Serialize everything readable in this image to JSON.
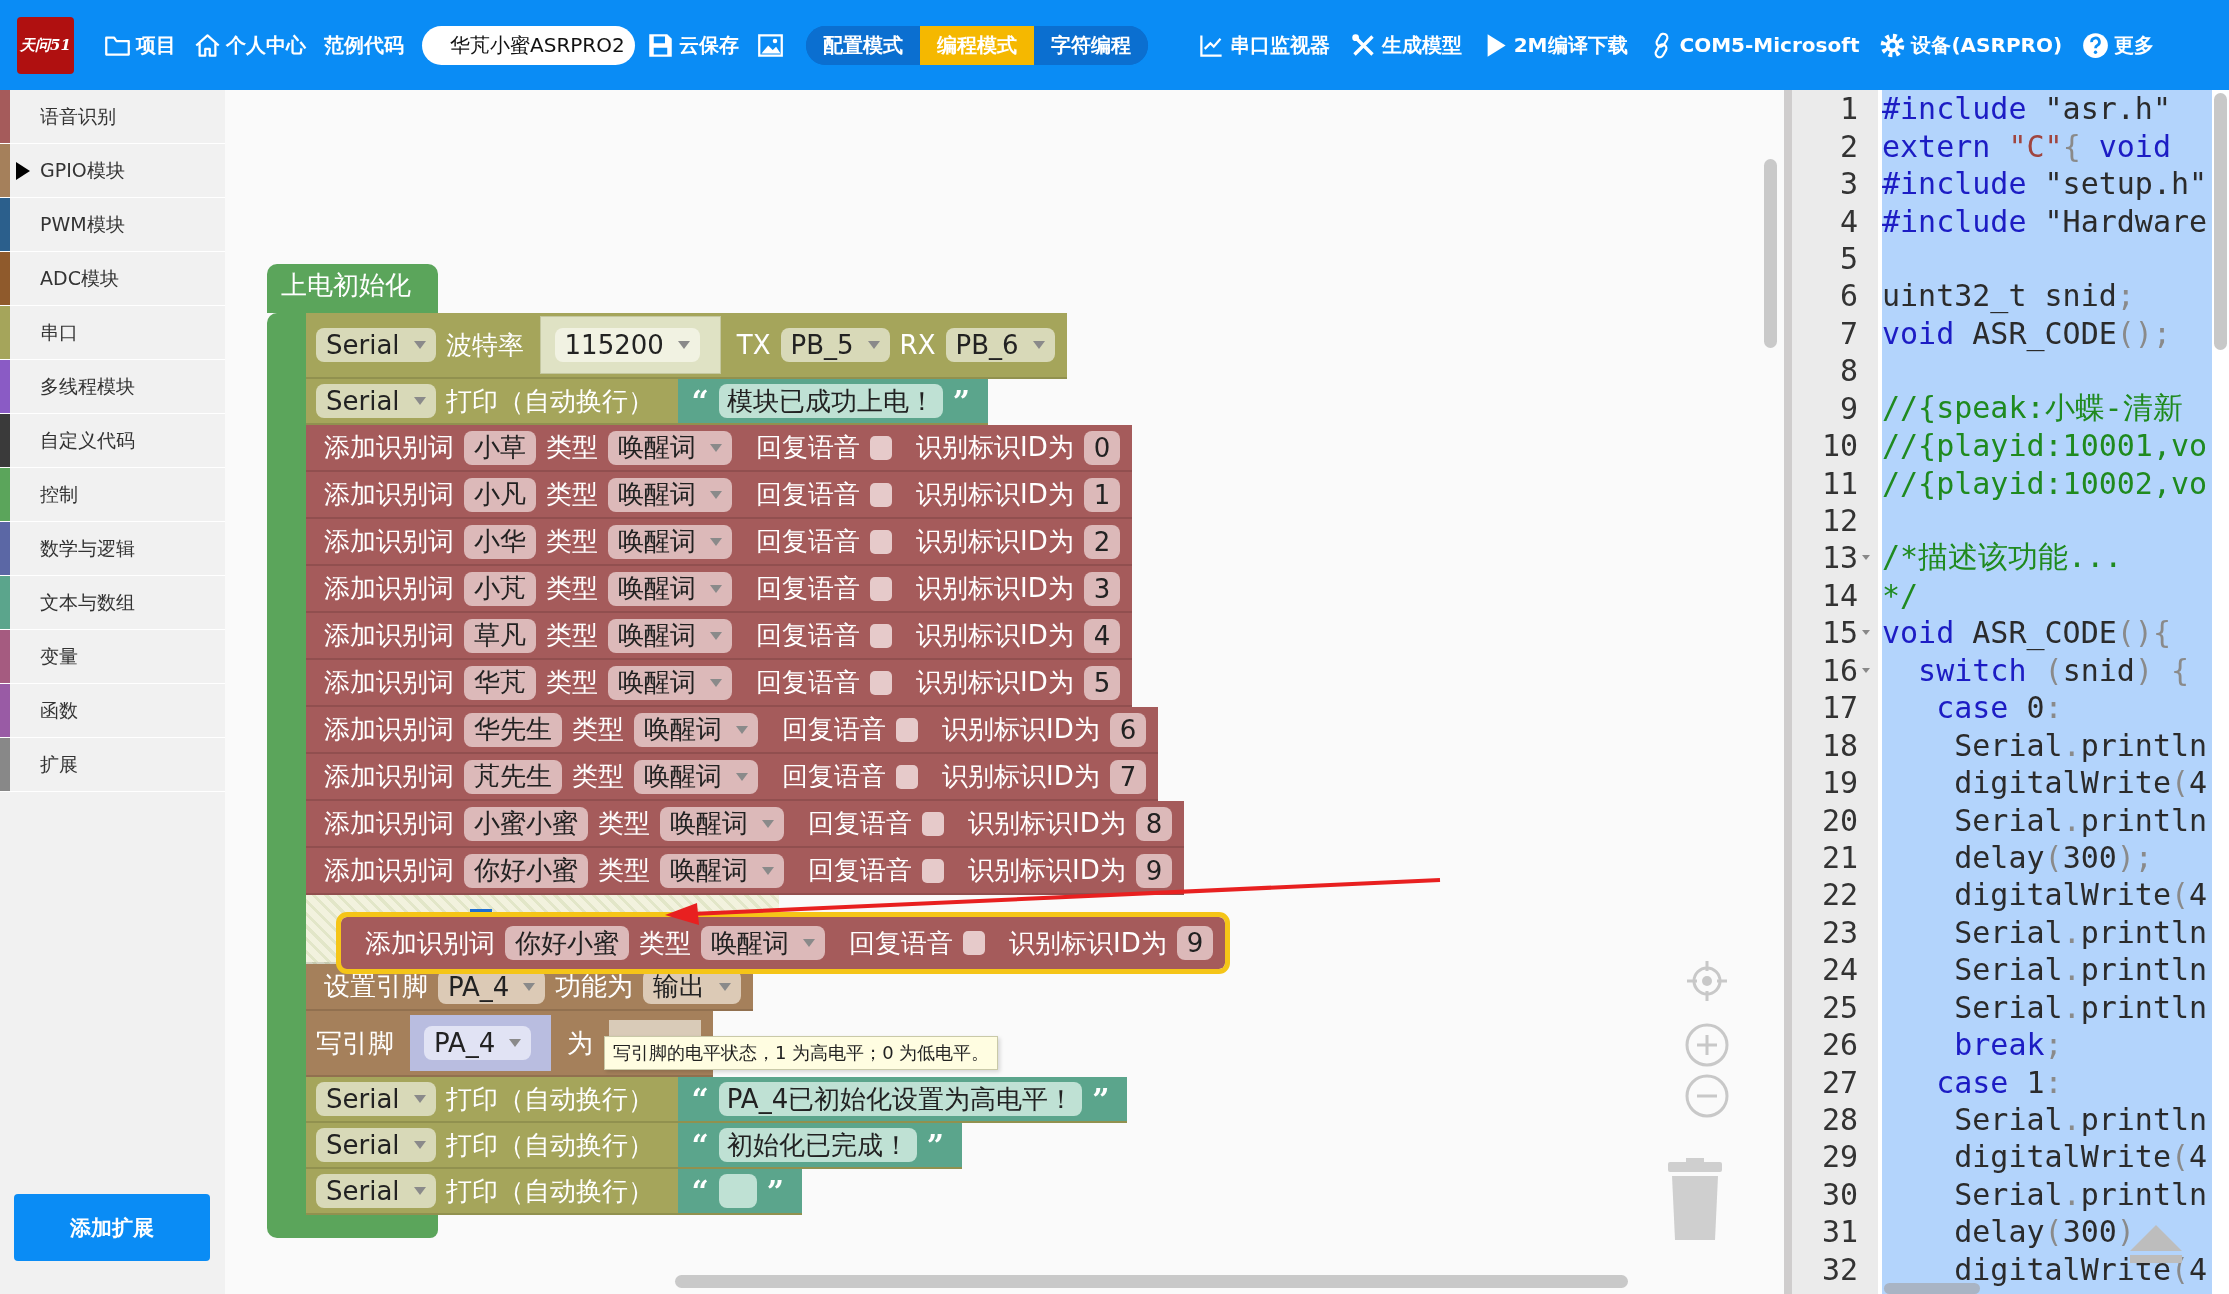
{
  "toolbar": {
    "logo": "天问51",
    "left": [
      {
        "label": "项目"
      },
      {
        "label": "个人中心"
      },
      {
        "label": "范例代码"
      }
    ],
    "project_name": "华芃小蜜ASRPRO2",
    "save": {
      "label": "云保存"
    },
    "modes": [
      {
        "label": "配置模式",
        "selected": false
      },
      {
        "label": "编程模式",
        "selected": true
      },
      {
        "label": "字符编程",
        "selected": false
      }
    ],
    "right": [
      {
        "label": "串口监视器"
      },
      {
        "label": "生成模型"
      },
      {
        "label": "2M编译下载"
      },
      {
        "label": "COM5-Microsoft"
      },
      {
        "label": "设备(ASRPRO)"
      },
      {
        "label": "更多"
      }
    ]
  },
  "sidebar": {
    "items": [
      {
        "label": "语音识别",
        "color": "#a55b5b",
        "selected": false
      },
      {
        "label": "GPIO模块",
        "color": "#a5805b",
        "selected": true
      },
      {
        "label": "PWM模块",
        "color": "#2b5f8c",
        "selected": false
      },
      {
        "label": "ADC模块",
        "color": "#8f5a2c",
        "selected": false
      },
      {
        "label": "串口",
        "color": "#a5a55b",
        "selected": false
      },
      {
        "label": "多线程模块",
        "color": "#8a5bc5",
        "selected": false
      },
      {
        "label": "自定义代码",
        "color": "#3a3a3a",
        "selected": false
      },
      {
        "label": "控制",
        "color": "#5ba55b",
        "selected": false
      },
      {
        "label": "数学与逻辑",
        "color": "#5b67a5",
        "selected": false
      },
      {
        "label": "文本与数组",
        "color": "#5ba58c",
        "selected": false
      },
      {
        "label": "变量",
        "color": "#a55b80",
        "selected": false
      },
      {
        "label": "函数",
        "color": "#995ba5",
        "selected": false
      },
      {
        "label": "扩展",
        "color": "#888888",
        "selected": false
      }
    ],
    "add_button": "添加扩展"
  },
  "workspace": {
    "hat": {
      "label": "上电初始化",
      "blocks": [
        {
          "kind": "serial_begin",
          "port": "Serial",
          "label": "波特率",
          "baud": "115200",
          "tx_label": "TX",
          "tx": "PB_5",
          "rx_label": "RX",
          "rx": "PB_6"
        },
        {
          "kind": "serial_print",
          "port": "Serial",
          "label": "打印（自动换行）",
          "open": "“",
          "text": "模块已成功上电！",
          "close": "”"
        },
        {
          "kind": "add_word",
          "label": "添加识别词",
          "word": "小草",
          "type_label": "类型",
          "type": "唤醒词",
          "reply_label": "回复语音",
          "reply_checked": false,
          "id_label": "识别标识ID为",
          "id": "0"
        },
        {
          "kind": "add_word",
          "label": "添加识别词",
          "word": "小凡",
          "type_label": "类型",
          "type": "唤醒词",
          "reply_label": "回复语音",
          "reply_checked": false,
          "id_label": "识别标识ID为",
          "id": "1"
        },
        {
          "kind": "add_word",
          "label": "添加识别词",
          "word": "小华",
          "type_label": "类型",
          "type": "唤醒词",
          "reply_label": "回复语音",
          "reply_checked": false,
          "id_label": "识别标识ID为",
          "id": "2"
        },
        {
          "kind": "add_word",
          "label": "添加识别词",
          "word": "小芃",
          "type_label": "类型",
          "type": "唤醒词",
          "reply_label": "回复语音",
          "reply_checked": false,
          "id_label": "识别标识ID为",
          "id": "3"
        },
        {
          "kind": "add_word",
          "label": "添加识别词",
          "word": "草凡",
          "type_label": "类型",
          "type": "唤醒词",
          "reply_label": "回复语音",
          "reply_checked": false,
          "id_label": "识别标识ID为",
          "id": "4"
        },
        {
          "kind": "add_word",
          "label": "添加识别词",
          "word": "华芃",
          "type_label": "类型",
          "type": "唤醒词",
          "reply_label": "回复语音",
          "reply_checked": false,
          "id_label": "识别标识ID为",
          "id": "5"
        },
        {
          "kind": "add_word",
          "label": "添加识别词",
          "word": "华先生",
          "type_label": "类型",
          "type": "唤醒词",
          "reply_label": "回复语音",
          "reply_checked": false,
          "id_label": "识别标识ID为",
          "id": "6"
        },
        {
          "kind": "add_word",
          "label": "添加识别词",
          "word": "芃先生",
          "type_label": "类型",
          "type": "唤醒词",
          "reply_label": "回复语音",
          "reply_checked": false,
          "id_label": "识别标识ID为",
          "id": "7"
        },
        {
          "kind": "add_word",
          "label": "添加识别词",
          "word": "小蜜小蜜",
          "type_label": "类型",
          "type": "唤醒词",
          "reply_label": "回复语音",
          "reply_checked": false,
          "id_label": "识别标识ID为",
          "id": "8"
        },
        {
          "kind": "add_word",
          "label": "添加识别词",
          "word": "你好小蜜",
          "type_label": "类型",
          "type": "唤醒词",
          "reply_label": "回复语音",
          "reply_checked": false,
          "id_label": "识别标识ID为",
          "id": "9"
        },
        {
          "kind": "comment"
        },
        {
          "kind": "pin_mode",
          "label": "设置引脚",
          "pin": "PA_4",
          "func_label": "功能为",
          "mode": "输出"
        },
        {
          "kind": "digital_write",
          "label": "写引脚",
          "pin": "PA_4",
          "to_label": "为"
        },
        {
          "kind": "serial_print",
          "port": "Serial",
          "label": "打印（自动换行）",
          "open": "“",
          "text": "PA_4已初始化设置为高电平！",
          "close": "”"
        },
        {
          "kind": "serial_print",
          "port": "Serial",
          "label": "打印（自动换行）",
          "open": "“",
          "text": "初始化已完成！",
          "close": "”"
        },
        {
          "kind": "serial_print",
          "port": "Serial",
          "label": "打印（自动换行）",
          "open": "“",
          "close": "”"
        }
      ]
    },
    "dragged": {
      "kind": "add_word",
      "selected": true,
      "label": "添加识别词",
      "word": "你好小蜜",
      "type_label": "类型",
      "type": "唤醒词",
      "reply_label": "回复语音",
      "reply_checked": false,
      "id_label": "识别标识ID为",
      "id": "9"
    },
    "tooltip": "写引脚的电平状态，1 为高电平；0 为低电平。"
  },
  "code": {
    "lines": [
      {
        "number": "1",
        "fold": false,
        "tokens": [
          {
            "kind": "kw",
            "text": "#include"
          },
          {
            "kind": "plain",
            "text": " \"asr.h\""
          }
        ]
      },
      {
        "number": "2",
        "fold": false,
        "tokens": [
          {
            "kind": "kw",
            "text": "extern"
          },
          {
            "kind": "str",
            "text": " \"C\""
          },
          {
            "kind": "punct",
            "text": "{"
          },
          {
            "kind": "kw",
            "text": " void"
          }
        ]
      },
      {
        "number": "3",
        "fold": false,
        "tokens": [
          {
            "kind": "kw",
            "text": "#include"
          },
          {
            "kind": "plain",
            "text": " \"setup.h\""
          }
        ]
      },
      {
        "number": "4",
        "fold": false,
        "tokens": [
          {
            "kind": "kw",
            "text": "#include"
          },
          {
            "kind": "plain",
            "text": " \"Hardware"
          }
        ]
      },
      {
        "number": "5",
        "fold": false
      },
      {
        "number": "6",
        "fold": false,
        "tokens": [
          {
            "kind": "plain",
            "text": "uint32_t snid"
          },
          {
            "kind": "punct",
            "text": ";"
          }
        ]
      },
      {
        "number": "7",
        "fold": false,
        "tokens": [
          {
            "kind": "kw",
            "text": "void"
          },
          {
            "kind": "plain",
            "text": " ASR_CODE"
          },
          {
            "kind": "punct",
            "text": "();"
          }
        ]
      },
      {
        "number": "8",
        "fold": false
      },
      {
        "number": "9",
        "fold": false,
        "tokens": [
          {
            "kind": "cmt",
            "text": "//{speak:小蝶-清新"
          }
        ]
      },
      {
        "number": "10",
        "fold": false,
        "tokens": [
          {
            "kind": "cmt",
            "text": "//{playid:10001,vo"
          }
        ]
      },
      {
        "number": "11",
        "fold": false,
        "tokens": [
          {
            "kind": "cmt",
            "text": "//{playid:10002,vo"
          }
        ]
      },
      {
        "number": "12",
        "fold": false
      },
      {
        "number": "13",
        "fold": true,
        "tokens": [
          {
            "kind": "cmt",
            "text": "/*描述该功能..."
          }
        ]
      },
      {
        "number": "14",
        "fold": false,
        "tokens": [
          {
            "kind": "cmt",
            "text": "*/"
          }
        ]
      },
      {
        "number": "15",
        "fold": true,
        "tokens": [
          {
            "kind": "kw",
            "text": "void"
          },
          {
            "kind": "plain",
            "text": " ASR_CODE"
          },
          {
            "kind": "punct",
            "text": "(){"
          }
        ]
      },
      {
        "number": "16",
        "fold": true,
        "tokens": [
          {
            "kind": "kw",
            "text": "  switch"
          },
          {
            "kind": "punct",
            "text": " ("
          },
          {
            "kind": "plain",
            "text": "snid"
          },
          {
            "kind": "punct",
            "text": ") {"
          }
        ]
      },
      {
        "number": "17",
        "fold": false,
        "tokens": [
          {
            "kind": "kw",
            "text": "   case"
          },
          {
            "kind": "plain",
            "text": " 0"
          },
          {
            "kind": "punct",
            "text": ":"
          }
        ]
      },
      {
        "number": "18",
        "fold": false,
        "tokens": [
          {
            "kind": "plain",
            "text": "    Serial"
          },
          {
            "kind": "punct",
            "text": "."
          },
          {
            "kind": "plain",
            "text": "println"
          }
        ]
      },
      {
        "number": "19",
        "fold": false,
        "tokens": [
          {
            "kind": "plain",
            "text": "    digitalWrite"
          },
          {
            "kind": "punct",
            "text": "("
          },
          {
            "kind": "plain",
            "text": "4"
          }
        ]
      },
      {
        "number": "20",
        "fold": false,
        "tokens": [
          {
            "kind": "plain",
            "text": "    Serial"
          },
          {
            "kind": "punct",
            "text": "."
          },
          {
            "kind": "plain",
            "text": "println"
          }
        ]
      },
      {
        "number": "21",
        "fold": false,
        "tokens": [
          {
            "kind": "plain",
            "text": "    delay"
          },
          {
            "kind": "punct",
            "text": "("
          },
          {
            "kind": "plain",
            "text": "300"
          },
          {
            "kind": "punct",
            "text": ");"
          }
        ]
      },
      {
        "number": "22",
        "fold": false,
        "tokens": [
          {
            "kind": "plain",
            "text": "    digitalWrite"
          },
          {
            "kind": "punct",
            "text": "("
          },
          {
            "kind": "plain",
            "text": "4"
          }
        ]
      },
      {
        "number": "23",
        "fold": false,
        "tokens": [
          {
            "kind": "plain",
            "text": "    Serial"
          },
          {
            "kind": "punct",
            "text": "."
          },
          {
            "kind": "plain",
            "text": "println"
          }
        ]
      },
      {
        "number": "24",
        "fold": false,
        "tokens": [
          {
            "kind": "plain",
            "text": "    Serial"
          },
          {
            "kind": "punct",
            "text": "."
          },
          {
            "kind": "plain",
            "text": "println"
          }
        ]
      },
      {
        "number": "25",
        "fold": false,
        "tokens": [
          {
            "kind": "plain",
            "text": "    Serial"
          },
          {
            "kind": "punct",
            "text": "."
          },
          {
            "kind": "plain",
            "text": "println"
          }
        ]
      },
      {
        "number": "26",
        "fold": false,
        "tokens": [
          {
            "kind": "kw",
            "text": "    break"
          },
          {
            "kind": "punct",
            "text": ";"
          }
        ]
      },
      {
        "number": "27",
        "fold": false,
        "tokens": [
          {
            "kind": "kw",
            "text": "   case"
          },
          {
            "kind": "plain",
            "text": " 1"
          },
          {
            "kind": "punct",
            "text": ":"
          }
        ]
      },
      {
        "number": "28",
        "fold": false,
        "tokens": [
          {
            "kind": "plain",
            "text": "    Serial"
          },
          {
            "kind": "punct",
            "text": "."
          },
          {
            "kind": "plain",
            "text": "println"
          }
        ]
      },
      {
        "number": "29",
        "fold": false,
        "tokens": [
          {
            "kind": "plain",
            "text": "    digitalWrite"
          },
          {
            "kind": "punct",
            "text": "("
          },
          {
            "kind": "plain",
            "text": "4"
          }
        ]
      },
      {
        "number": "30",
        "fold": false,
        "tokens": [
          {
            "kind": "plain",
            "text": "    Serial"
          },
          {
            "kind": "punct",
            "text": "."
          },
          {
            "kind": "plain",
            "text": "println"
          }
        ]
      },
      {
        "number": "31",
        "fold": false,
        "tokens": [
          {
            "kind": "plain",
            "text": "    delay"
          },
          {
            "kind": "punct",
            "text": "("
          },
          {
            "kind": "plain",
            "text": "300"
          },
          {
            "kind": "punct",
            "text": ")"
          }
        ]
      },
      {
        "number": "32",
        "fold": false,
        "tokens": [
          {
            "kind": "plain",
            "text": "    digitalWrite"
          },
          {
            "kind": "punct",
            "text": "("
          },
          {
            "kind": "plain",
            "text": "4"
          }
        ]
      }
    ]
  }
}
